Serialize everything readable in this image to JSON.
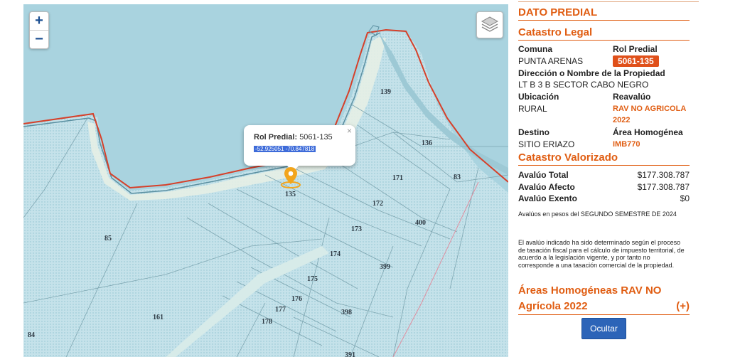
{
  "map": {
    "zoom_in": "+",
    "zoom_out": "−",
    "popup": {
      "label": "Rol Predial:",
      "value": "5061-135",
      "coords": "-52.925051   -70.847818",
      "close": "×"
    },
    "lots": [
      "139",
      "136",
      "171",
      "83",
      "172",
      "400",
      "173",
      "85",
      "174",
      "399",
      "175",
      "176",
      "177",
      "398",
      "161",
      "178",
      "84",
      "391",
      "135"
    ],
    "colors": {
      "water": "#a9d3df",
      "land": "#c7e3ea",
      "boundary": "#d6402a",
      "marker": "#f2a51c",
      "accent": "#e05d12"
    },
    "icons": {
      "layers": "layers-icon",
      "marker": "map-marker-icon"
    }
  },
  "panel": {
    "title": "DATO PREDIAL",
    "legal": {
      "heading": "Catastro Legal",
      "comuna_label": "Comuna",
      "comuna_value": "PUNTA ARENAS",
      "rol_label": "Rol Predial",
      "rol_value": "5061-135",
      "direccion_label": "Dirección o Nombre de la Propiedad",
      "direccion_value": "LT B 3 B SECTOR CABO NEGRO",
      "ubicacion_label": "Ubicación",
      "ubicacion_value": "RURAL",
      "reavaluo_label": "Reavalúo",
      "reavaluo_value_1": "RAV NO AGRICOLA",
      "reavaluo_value_2": "2022",
      "destino_label": "Destino",
      "destino_value": "SITIO ERIAZO",
      "area_label": "Área Homogénea",
      "area_value": "IMB770"
    },
    "valorizado": {
      "heading": "Catastro Valorizado",
      "total_label": "Avalúo Total",
      "total_value": "$177.308.787",
      "afecto_label": "Avalúo Afecto",
      "afecto_value": "$177.308.787",
      "exento_label": "Avalúo Exento",
      "exento_value": "$0",
      "note1": "Avalúos en pesos del SEGUNDO SEMESTRE DE 2024",
      "note2": "El avalúo indicado ha sido determinado según el proceso de tasación fiscal para el cálculo de impuesto territorial, de acuerdo a la legislación vigente, y por tanto no corresponde a una tasación comercial de la propiedad."
    },
    "areas_heading_1": "Áreas Homogéneas RAV NO",
    "areas_heading_2": "Agrícola 2022",
    "areas_toggle": "(+)",
    "hide_button": "Ocultar"
  }
}
